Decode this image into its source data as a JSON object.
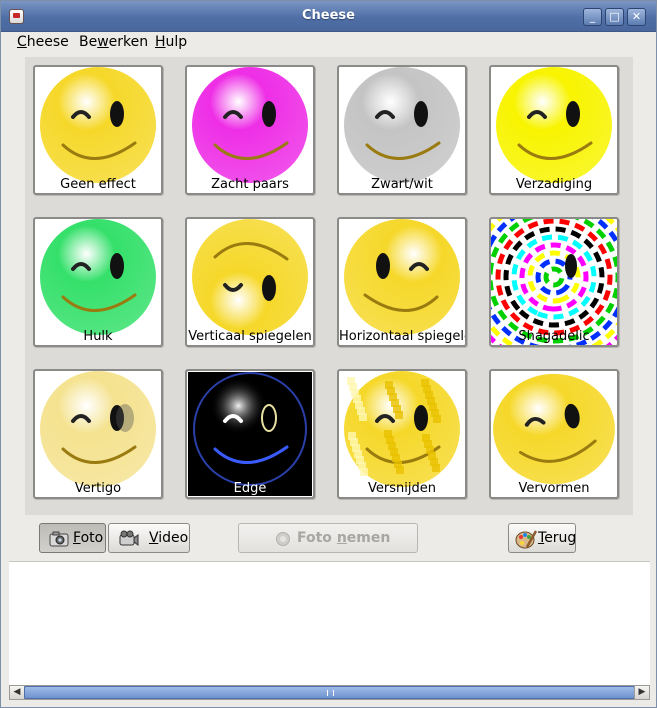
{
  "window": {
    "title": "Cheese"
  },
  "menubar": {
    "items": [
      {
        "mnemonic": "C",
        "rest": "heese"
      },
      {
        "prefix": "Be",
        "mnemonic": "w",
        "rest": "erken"
      },
      {
        "mnemonic": "H",
        "rest": "ulp"
      }
    ]
  },
  "effects": [
    {
      "label": "Geen effect",
      "color": "#f6d82a",
      "effect": "none"
    },
    {
      "label": "Zacht paars",
      "color": "#ee2ee6",
      "effect": "soft-purple"
    },
    {
      "label": "Zwart/wit",
      "color": "#c4c4c4",
      "effect": "grayscale"
    },
    {
      "label": "Verzadiging",
      "color": "#f8f400",
      "effect": "saturation"
    },
    {
      "label": "Hulk",
      "color": "#34e06a",
      "effect": "hulk"
    },
    {
      "label": "Verticaal spiegelen",
      "color": "#f6d82a",
      "effect": "vertical-flip"
    },
    {
      "label": "Horizontaal spiegelen",
      "color": "#f6d82a",
      "effect": "horizontal-flip"
    },
    {
      "label": "Shagadelic",
      "color": "#ff0000",
      "effect": "shagadelic"
    },
    {
      "label": "Vertigo",
      "color": "#f1d96a",
      "effect": "vertigo"
    },
    {
      "label": "Edge",
      "color": "#3050d0",
      "effect": "edge"
    },
    {
      "label": "Versnijden",
      "color": "#f6d82a",
      "effect": "dice"
    },
    {
      "label": "Vervormen",
      "color": "#f6d82a",
      "effect": "warp"
    }
  ],
  "buttons": {
    "foto": {
      "mnemonic": "F",
      "rest": "oto",
      "icon": "camera-icon",
      "pressed": true
    },
    "video": {
      "mnemonic": "V",
      "rest": "ideo",
      "icon": "camcorder-icon"
    },
    "take_photo": {
      "prefix": "Foto ",
      "mnemonic": "n",
      "rest": "emen",
      "enabled": false
    },
    "back": {
      "mnemonic": "T",
      "rest": "erug",
      "icon": "palette-icon"
    }
  },
  "scrollbar": {
    "grip": "III"
  }
}
